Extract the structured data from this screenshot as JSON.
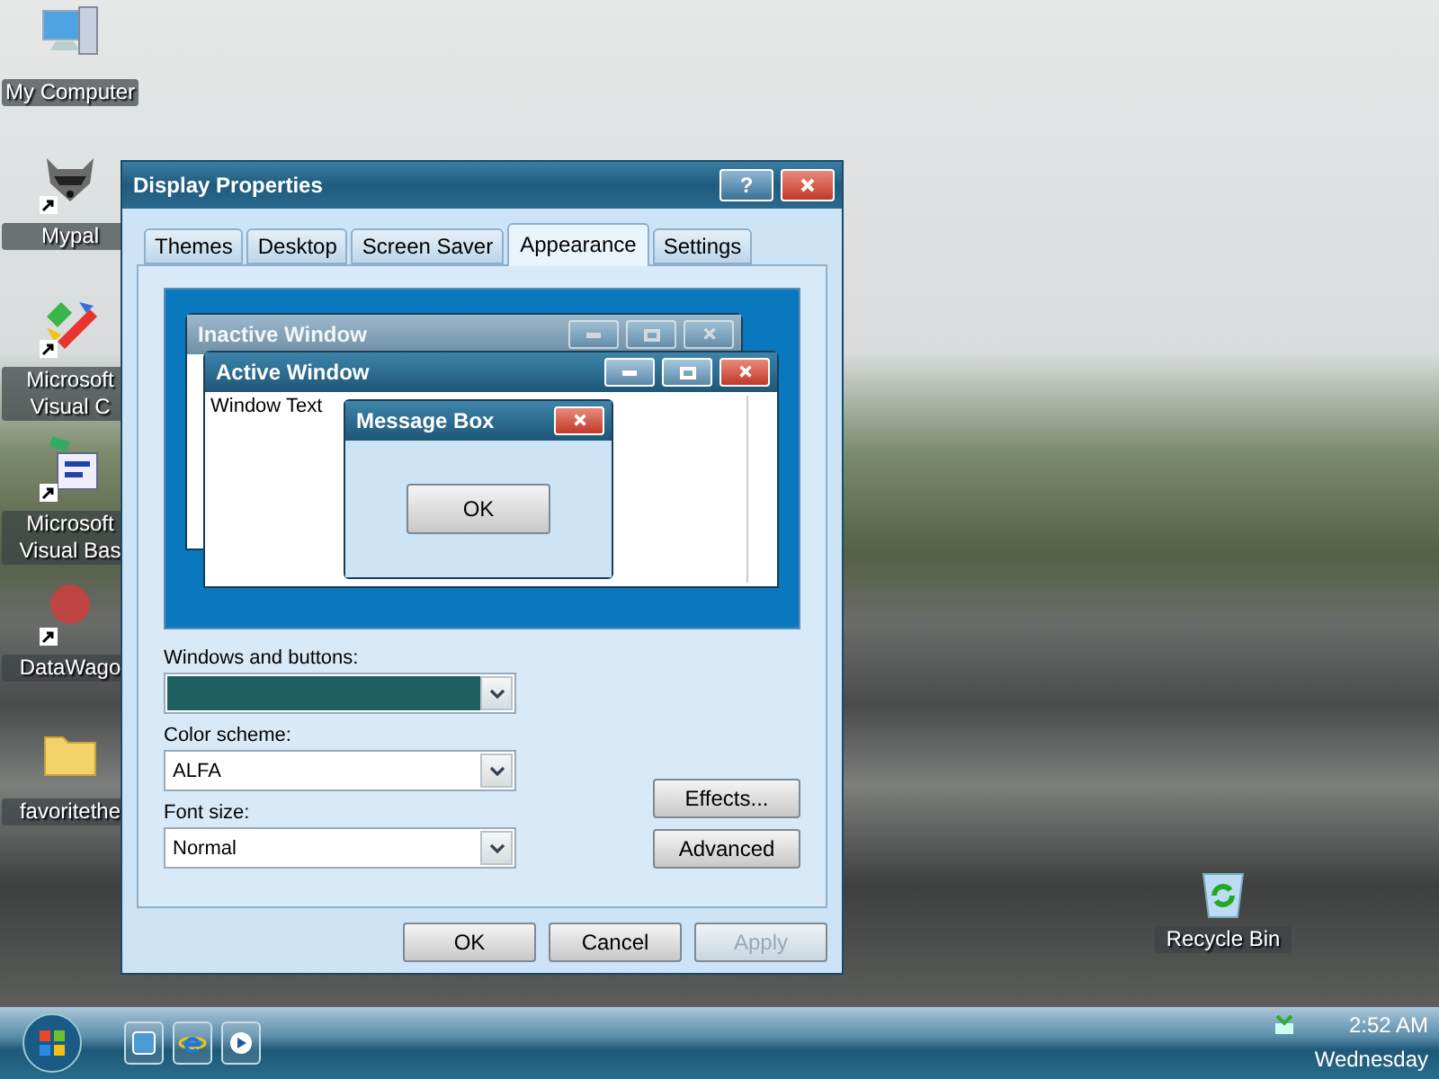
{
  "desktop_icons": [
    {
      "label": "My Computer",
      "kind": "computer",
      "shortcut": false
    },
    {
      "label": "Mypal",
      "kind": "raccoon",
      "shortcut": true
    },
    {
      "label": "Microsoft Visual C",
      "kind": "studio",
      "shortcut": true
    },
    {
      "label": "Microsoft Visual Bas",
      "kind": "vb",
      "shortcut": true
    },
    {
      "label": "DataWago",
      "kind": "wagon",
      "shortcut": true
    },
    {
      "label": "favoritethe",
      "kind": "folder",
      "shortcut": false
    }
  ],
  "recycle_bin": {
    "label": "Recycle Bin"
  },
  "dialog": {
    "title": "Display Properties",
    "help_button": "?",
    "tabs": [
      {
        "label": "Themes",
        "selected": false
      },
      {
        "label": "Desktop",
        "selected": false
      },
      {
        "label": "Screen Saver",
        "selected": false
      },
      {
        "label": "Appearance",
        "selected": true
      },
      {
        "label": "Settings",
        "selected": false
      }
    ],
    "preview": {
      "inactive_title": "Inactive Window",
      "active_title": "Active Window",
      "window_text": "Window Text",
      "message_title": "Message Box",
      "message_button": "OK"
    },
    "fields": [
      {
        "label": "Windows and buttons:",
        "kind": "swatch"
      },
      {
        "label": "Color scheme:",
        "kind": "text",
        "value": "ALFA"
      },
      {
        "label": "Font size:",
        "kind": "text",
        "value": "Normal"
      }
    ],
    "side_buttons": [
      "Effects...",
      "Advanced"
    ],
    "buttons": [
      {
        "label": "OK",
        "disabled": false
      },
      {
        "label": "Cancel",
        "disabled": false
      },
      {
        "label": "Apply",
        "disabled": true
      }
    ]
  },
  "taskbar": {
    "clock": "2:52 AM",
    "day": "Wednesday"
  }
}
